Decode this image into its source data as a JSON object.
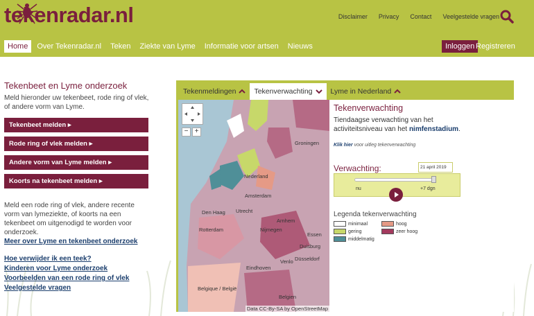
{
  "colors": {
    "accent": "#7a1f3d",
    "header_bg": "#b8c344",
    "link": "#1c3f6e"
  },
  "header": {
    "logo": "tekenradar.nl",
    "top_links": [
      "Disclaimer",
      "Privacy",
      "Contact",
      "Veelgestelde vragen"
    ],
    "search_icon": "search-icon",
    "nav": [
      "Home",
      "Over Tekenradar.nl",
      "Teken",
      "Ziekte van Lyme",
      "Informatie voor artsen",
      "Nieuws"
    ],
    "login": "Inloggen",
    "register": "Registreren"
  },
  "left": {
    "title": "Tekenbeet en Lyme onderzoek",
    "intro": "Meld hieronder uw tekenbeet, rode ring of vlek, of andere vorm van Lyme.",
    "buttons": [
      "Tekenbeet melden ▸",
      "Rode ring of vlek melden ▸",
      "Andere vorm van Lyme melden ▸",
      "Koorts na tekenbeet melden ▸"
    ],
    "para": "Meld een rode ring of vlek, andere recente vorm van lymeziekte, of koorts na een tekenbeet om uitgenodigd te worden voor onderzoek.",
    "para_link": "Meer over Lyme en tekenbeet onderzoek",
    "links": [
      "Hoe verwijder ik een teek?",
      "Kinderen voor Lyme onderzoek",
      "Voorbeelden van een rode ring of vlek",
      "Veelgestelde vragen"
    ]
  },
  "widget": {
    "tabs": [
      "Tekenmeldingen",
      "Tekenverwachting",
      "Lyme in Nederland"
    ],
    "panel": {
      "title": "Tekenverwachting",
      "desc_prefix": "Tiendaagse verwachting van het activiteitsniveau van het ",
      "desc_bold": "nimfenstadium",
      "desc_suffix": ".",
      "hint_bold": "Klik hier",
      "hint_rest": " voor uitleg tekenverwachting",
      "forecast_label": "Verwachting:",
      "date": "21 april 2019",
      "slider_min": "nu",
      "slider_max": "+7 dgn",
      "legend_title": "Legenda tekenverwachting",
      "legend": [
        {
          "label": "minimaal",
          "color": "#ffffff"
        },
        {
          "label": "gering",
          "color": "#c7d86a"
        },
        {
          "label": "middelmatig",
          "color": "#4f8f98"
        },
        {
          "label": "hoog",
          "color": "#e59a86"
        },
        {
          "label": "zeer hoog",
          "color": "#a33a5e"
        }
      ]
    },
    "map": {
      "labels": [
        "Groningen",
        "Nederland",
        "Amsterdam",
        "Den Haag",
        "Utrecht",
        "Rotterdam",
        "Nijmegen",
        "Arnhem",
        "Eindhoven",
        "Venlo",
        "Duisburg",
        "Düsseldorf",
        "Essen",
        "Belgique / België",
        "Belgien"
      ],
      "attribution": "Data CC-By-SA by OpenStreetMap"
    }
  }
}
